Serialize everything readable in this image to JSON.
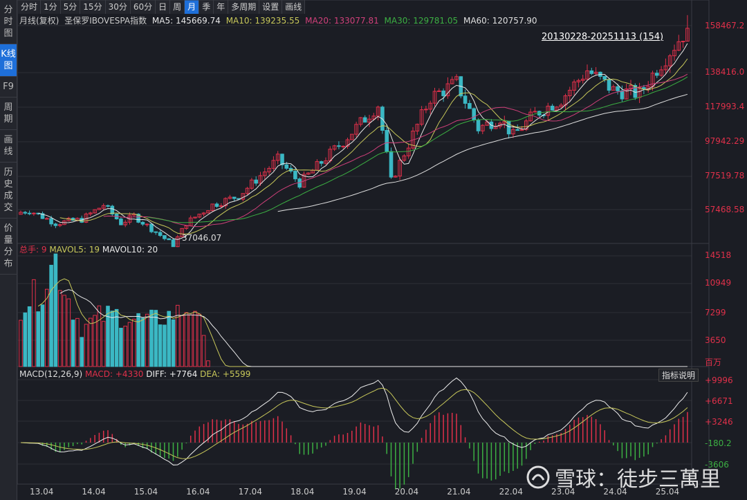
{
  "sidebar": [
    "分时图",
    "K线图",
    "F9",
    "周期",
    "画线",
    "历史成交",
    "价量分布"
  ],
  "sidebar_active": 1,
  "toolbar": [
    "分时",
    "1分",
    "5分",
    "15分",
    "30分",
    "60分",
    "日",
    "周",
    "月",
    "季",
    "年",
    "多周期",
    "设置",
    "画线"
  ],
  "toolbar_active": 8,
  "legend": {
    "title": "月线(复权)",
    "name": "圣保罗IBOVESPA指数",
    "ma5": "MA5: 145669.74",
    "ma10": "MA10: 139235.55",
    "ma20": "MA20: 133077.81",
    "ma30": "MA30: 129781.05",
    "ma60": "MA60: 120757.90"
  },
  "range_label": "20130228-20251113 (154)",
  "low_label": "37046.07",
  "price_axis": [
    "158467.2",
    "138416.0",
    "117993.4",
    "97942.29",
    "77519.78",
    "57468.58"
  ],
  "vol_legend": {
    "total": "总手: 9",
    "mavol5": "MAVOL5: 19",
    "mavol10": "MAVOL10: 20"
  },
  "vol_axis": [
    "14518",
    "10949",
    "7299",
    "3650",
    "百万"
  ],
  "macd_legend": {
    "name": "MACD(12,26,9)",
    "macd": "MACD: +4330",
    "diff": "DIFF: +7764",
    "dea": "DEA: +5599"
  },
  "indicator_button": "指标说明",
  "macd_axis": [
    "+9996",
    "+6671",
    "+3246",
    "-180.2",
    "-3606"
  ],
  "x_labels": [
    "13.04",
    "14.04",
    "15.04",
    "16.04",
    "17.04",
    "18.04",
    "19.04",
    "20.04",
    "21.04",
    "22.04",
    "23.04",
    "24.04",
    "25.04"
  ],
  "watermark": "雪球：徒步三萬里",
  "colors": {
    "up": "#e0304a",
    "down": "#3bb8c4",
    "ma5": "#e8e8e8",
    "ma10": "#c8c85a",
    "ma20": "#d0407a",
    "ma30": "#3cb043",
    "ma60": "#e0e0e0"
  },
  "chart_data": {
    "type": "candlestick",
    "count": 154,
    "close_keypoints": [
      [
        0,
        56000
      ],
      [
        2,
        57000
      ],
      [
        8,
        50000
      ],
      [
        14,
        52000
      ],
      [
        19,
        60000
      ],
      [
        23,
        50000
      ],
      [
        26,
        54000
      ],
      [
        35,
        38000
      ],
      [
        38,
        50000
      ],
      [
        44,
        60000
      ],
      [
        50,
        65000
      ],
      [
        59,
        85000
      ],
      [
        64,
        72000
      ],
      [
        74,
        95000
      ],
      [
        82,
        115000
      ],
      [
        85,
        73000
      ],
      [
        94,
        119000
      ],
      [
        100,
        127000
      ],
      [
        105,
        102000
      ],
      [
        110,
        108000
      ],
      [
        113,
        98000
      ],
      [
        118,
        110000
      ],
      [
        124,
        118000
      ],
      [
        130,
        134000
      ],
      [
        136,
        123000
      ],
      [
        142,
        121000
      ],
      [
        146,
        135000
      ],
      [
        153,
        157000
      ]
    ],
    "volume_keypoints": [
      [
        0,
        8000
      ],
      [
        4,
        9500
      ],
      [
        8,
        14000
      ],
      [
        11,
        9000
      ],
      [
        14,
        5000
      ],
      [
        18,
        6500
      ],
      [
        22,
        6800
      ],
      [
        26,
        6200
      ],
      [
        30,
        6000
      ],
      [
        36,
        7000
      ],
      [
        40,
        8000
      ],
      [
        43,
        1000
      ]
    ]
  }
}
